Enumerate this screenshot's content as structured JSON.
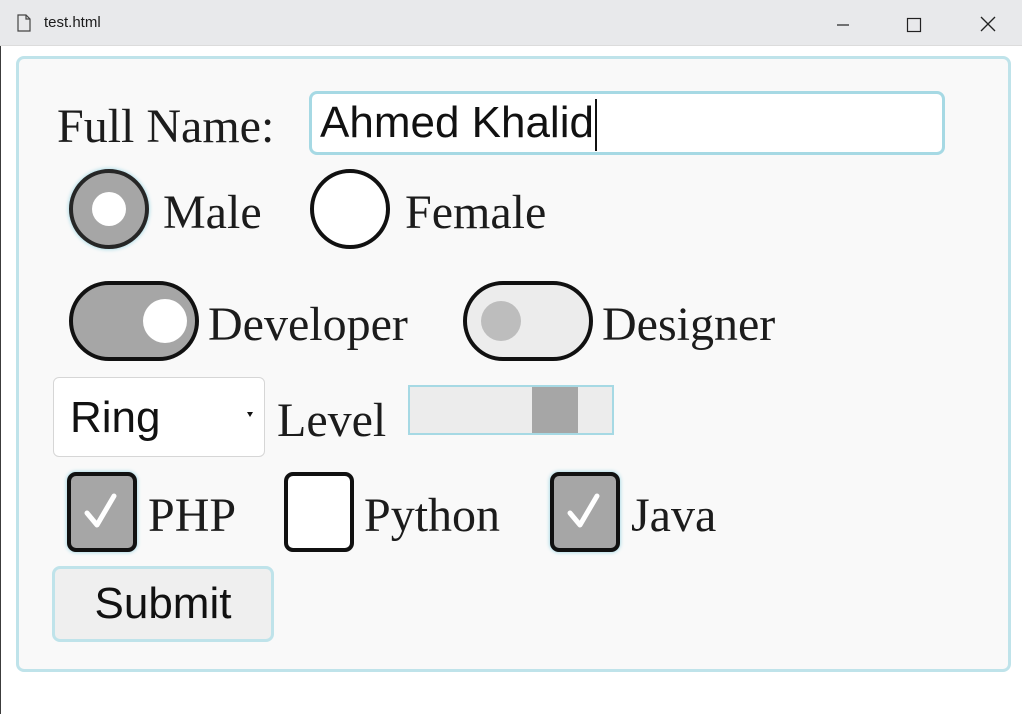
{
  "window": {
    "title": "test.html",
    "icons": {
      "doc": "document-icon",
      "minimize": "minimize-icon",
      "maximize": "maximize-icon",
      "close": "close-icon"
    }
  },
  "form": {
    "full_name": {
      "label": "Full Name:",
      "value": "Ahmed Khalid"
    },
    "gender": {
      "options": [
        {
          "label": "Male",
          "checked": true
        },
        {
          "label": "Female",
          "checked": false
        }
      ]
    },
    "roles": [
      {
        "label": "Developer",
        "on": true
      },
      {
        "label": "Designer",
        "on": false
      }
    ],
    "type_select": {
      "value": "Ring"
    },
    "level": {
      "label": "Level",
      "value_fraction": 0.72
    },
    "languages": [
      {
        "label": "PHP",
        "checked": true
      },
      {
        "label": "Python",
        "checked": false
      },
      {
        "label": "Java",
        "checked": true
      }
    ],
    "submit_label": "Submit"
  },
  "colors": {
    "accent_border": "#a6d9e4",
    "checked_fill": "#a6a6a6",
    "form_bg": "#f9f9f9"
  }
}
